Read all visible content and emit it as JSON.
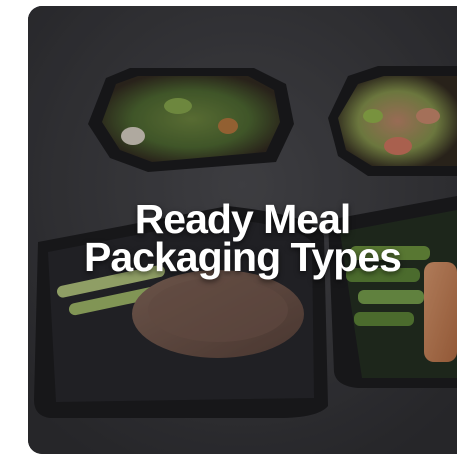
{
  "card": {
    "title_line1": "Ready Meal",
    "title_line2": "Packaging Types"
  },
  "colors": {
    "background": "#3a3a3d",
    "title": "#ffffff"
  }
}
